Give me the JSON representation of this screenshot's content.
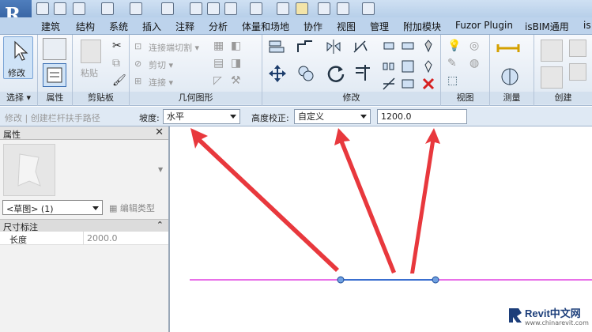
{
  "tabs": [
    "建筑",
    "结构",
    "系统",
    "插入",
    "注释",
    "分析",
    "体量和场地",
    "协作",
    "视图",
    "管理",
    "附加模块",
    "Fuzor Plugin",
    "isBIM通用",
    "is"
  ],
  "ribbon": {
    "select_panel": {
      "modify_label": "修改",
      "label": "选择 ▾"
    },
    "properties_panel": {
      "label": "属性"
    },
    "clipboard_panel": {
      "paste_label": "粘贴",
      "label": "剪贴板"
    },
    "geometry_panel": {
      "items": [
        "连接端切割 ▾",
        "剪切 ▾",
        "连接 ▾"
      ],
      "label": "几何图形"
    },
    "modify_panel": {
      "label": "修改"
    },
    "view_panel": {
      "label": "视图"
    },
    "measure_panel": {
      "label": "测量"
    },
    "create_panel": {
      "label": "创建"
    }
  },
  "optbar": {
    "context": "修改 | 创建栏杆扶手路径",
    "slope_label": "坡度:",
    "slope_value": "水平",
    "height_label": "高度校正:",
    "height_value": "自定义",
    "height_input": "1200.0"
  },
  "properties": {
    "title": "属性",
    "type_select": "<草图> (1)",
    "edit_type": "编辑类型",
    "group": "尺寸标注",
    "row_label": "长度",
    "row_value": "2000.0"
  },
  "watermark": {
    "title": "Revit中文网",
    "url": "www.chinarevit.com"
  },
  "colors": {
    "ribbon_bg": "#dde7f2",
    "accent_red": "#e8383d",
    "magenta_line": "#e040e0",
    "path_blue": "#3a6fd0"
  }
}
